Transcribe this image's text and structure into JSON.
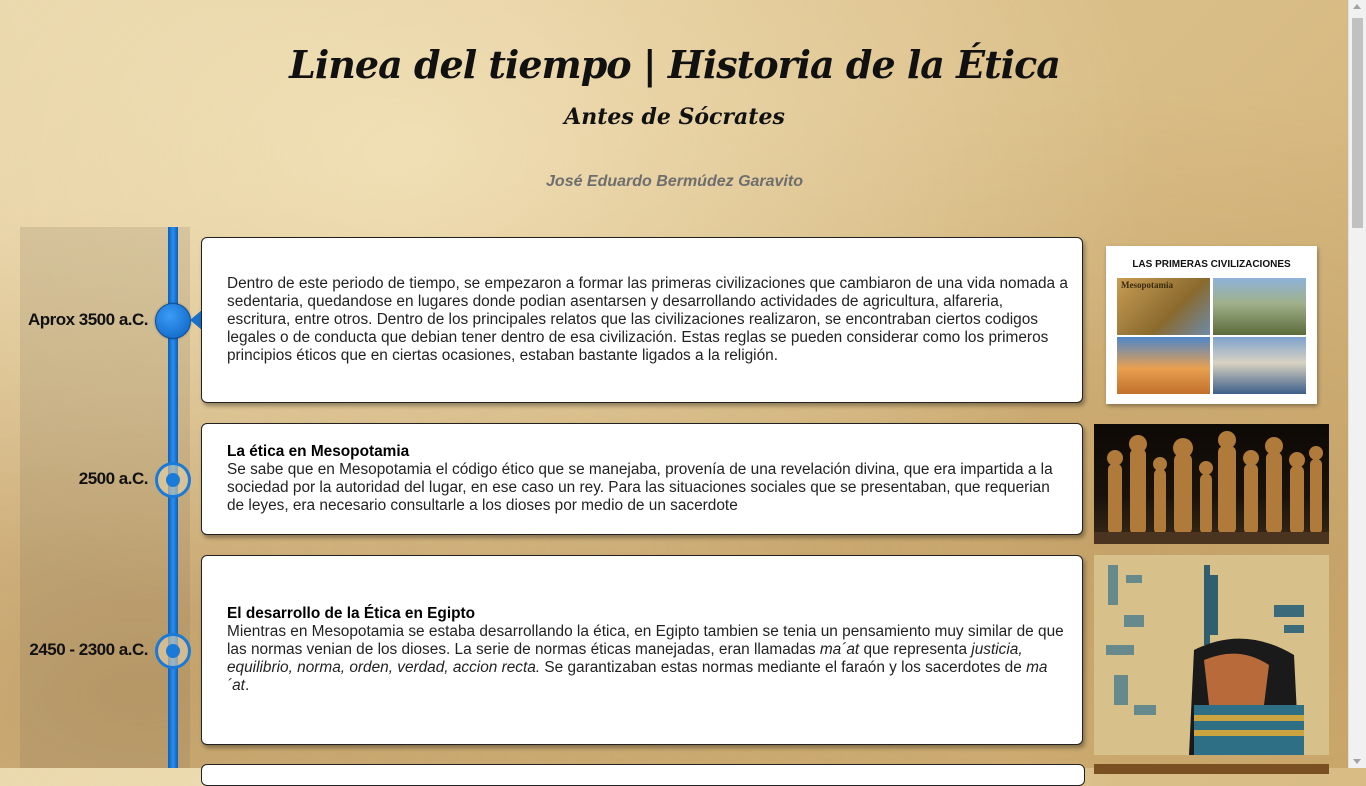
{
  "header": {
    "title": "Linea del tiempo | Historia de la Ética",
    "subtitle": "Antes de Sócrates",
    "author": "José Eduardo Bermúdez Garavito"
  },
  "colors": {
    "timeline_blue": "#1a7ad8",
    "parchment": "#dcc08c"
  },
  "timeline": [
    {
      "date": "Aprox 3500 a.C.",
      "marker": "filled-circle",
      "heading": "",
      "text": "Dentro de este periodo de tiempo, se empezaron a formar las primeras civilizaciones que cambiaron de una vida nomada a sedentaria, quedandose en lugares donde podian asentarsen y desarrollando actividades de agricultura, alfareria, escritura, entre otros. Dentro de los principales relatos que las civilizaciones realizaron, se encontraban ciertos codigos legales o de conducta que debian tener dentro de esa civilización. Estas reglas se pueden considerar como los primeros principios éticos que en ciertas ocasiones, estaban bastante ligados a la religión.",
      "image": {
        "title": "LAS PRIMERAS CIVILIZACIONES",
        "label": "Mesopotamia"
      }
    },
    {
      "date": "2500 a.C.",
      "marker": "ring-circle",
      "heading": "La ética en Mesopotamia",
      "text": "Se sabe que en Mesopotamia el código ético que se manejaba, provenía de una revelación divina, que era impartida a la sociedad por la autoridad del lugar, en ese caso un rey. Para las situaciones sociales que se presentaban, que requerian de leyes, era necesario consultarle a los dioses por medio de un sacerdote",
      "image": {
        "icon": "statuettes-photo"
      }
    },
    {
      "date": "2450 - 2300 a.C.",
      "marker": "ring-circle",
      "heading": "El desarrollo de la Ética en Egipto",
      "text_parts": [
        "Mientras en Mesopotamia se estaba desarrollando la ética, en Egipto tambien se tenia un pensamiento muy similar de que las normas venian de los dioses. La serie de normas éticas manejadas, eran llamadas ",
        "ma´at",
        " que representa ",
        "justicia, equilibrio, norma, orden, verdad, accion recta.",
        " Se garantizaban estas normas mediante el faraón y los sacerdotes de ",
        "ma´at",
        "."
      ],
      "image": {
        "icon": "egyptian-relief-photo"
      }
    }
  ]
}
